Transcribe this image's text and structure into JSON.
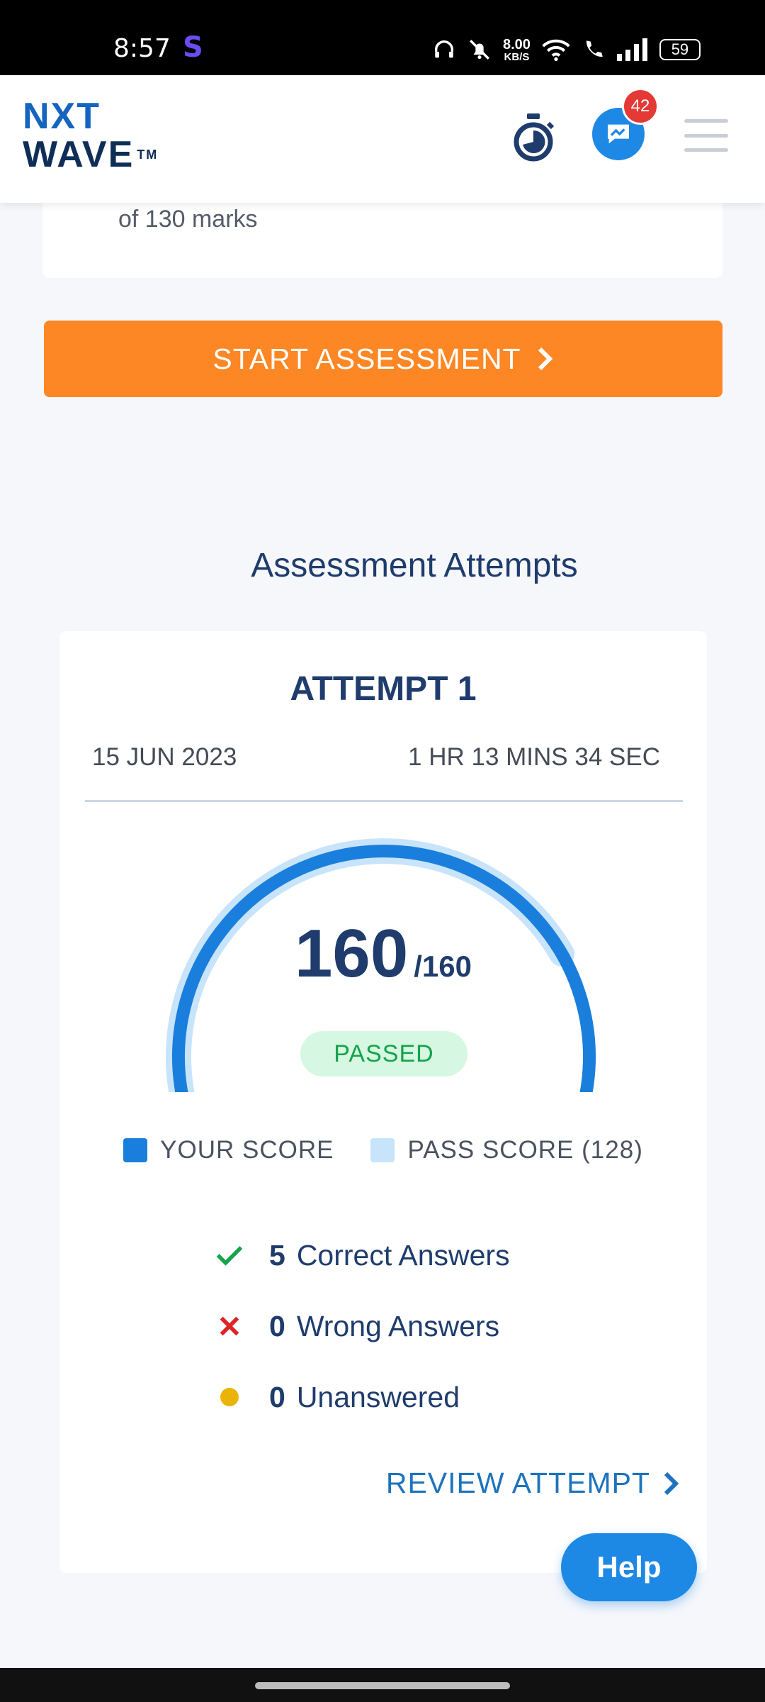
{
  "status_bar": {
    "time": "8:57",
    "app_letter": "S",
    "speed_value": "8.00",
    "speed_unit": "KB/S",
    "battery": "59"
  },
  "header": {
    "logo_line1": "NXT",
    "logo_line2": "WAVE",
    "logo_tm": "TM",
    "chat_badge_count": "42"
  },
  "top_card": {
    "text": "of 130 marks"
  },
  "start_button": {
    "label": "START ASSESSMENT",
    "icon": "chevron-right-icon"
  },
  "attempts_section": {
    "title": "Assessment Attempts"
  },
  "attempt": {
    "title": "ATTEMPT 1",
    "date": "15 JUN 2023",
    "duration": "1 HR 13 MINS 34 SEC",
    "score": "160",
    "total": "/160",
    "score_fraction": 1.0,
    "pass_fraction": 0.8,
    "status": "PASSED",
    "legend": {
      "your_score": "YOUR SCORE",
      "pass_score": "PASS SCORE (128)",
      "your_score_color": "#1a7fdc",
      "pass_score_color": "#c8e4fb"
    },
    "stats": [
      {
        "count": "5",
        "label": "Correct Answers",
        "icon": "check-icon",
        "color": "#16a34a"
      },
      {
        "count": "0",
        "label": "Wrong Answers",
        "icon": "cross-icon",
        "color": "#dc2626"
      },
      {
        "count": "0",
        "label": "Unanswered",
        "icon": "dot-icon",
        "color": "#eab308"
      }
    ],
    "review_label": "REVIEW ATTEMPT"
  },
  "help_button": {
    "label": "Help"
  },
  "colors": {
    "accent_orange": "#fd8724",
    "primary_blue": "#1e88e5",
    "navy": "#1f3c6d"
  }
}
